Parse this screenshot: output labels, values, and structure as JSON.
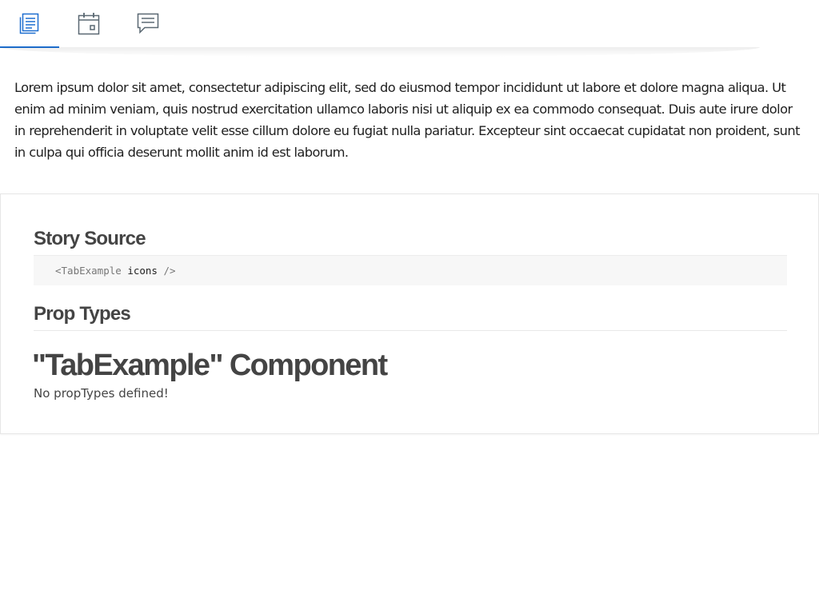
{
  "tabs": [
    {
      "icon": "document-list-icon",
      "active": true
    },
    {
      "icon": "calendar-icon",
      "active": false
    },
    {
      "icon": "chat-bubble-icon",
      "active": false
    }
  ],
  "colors": {
    "accent": "#1e6fd0",
    "icon_inactive": "#5a6872",
    "text": "#1f1f1f",
    "heading": "#444444"
  },
  "content": {
    "lorem": "Lorem ipsum dolor sit amet, consectetur adipiscing elit, sed do eiusmod tempor incididunt ut labore et dolore magna aliqua. Ut enim ad minim veniam, quis nostrud exercitation ullamco laboris nisi ut aliquip ex ea commodo consequat. Duis aute irure dolor in reprehenderit in voluptate velit esse cillum dolore eu fugiat nulla pariatur. Excepteur sint occaecat cupidatat non proident, sunt in culpa qui officia deserunt mollit anim id est laborum."
  },
  "info": {
    "story_source_title": "Story Source",
    "source_tag_open": "<TabExample ",
    "source_attr": "icons",
    "source_tag_close": " />",
    "prop_types_title": "Prop Types",
    "component_title": "\"TabExample\" Component",
    "no_prop_types": "No propTypes defined!"
  }
}
